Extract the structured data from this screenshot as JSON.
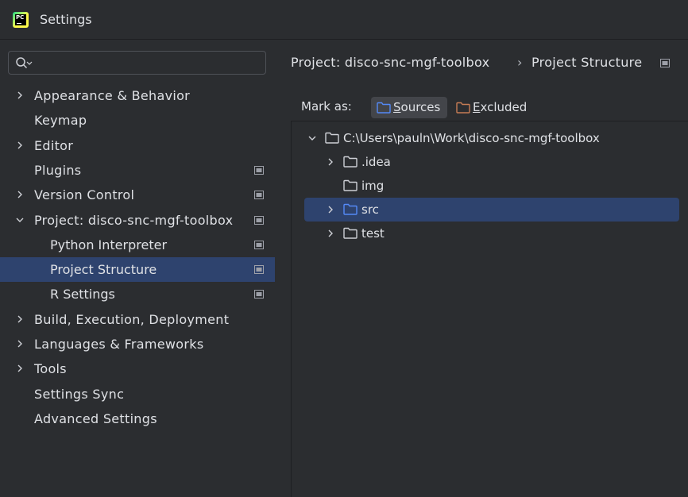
{
  "window": {
    "title": "Settings",
    "logo_text": "PC"
  },
  "search": {
    "value": "",
    "placeholder": ""
  },
  "sidebar": {
    "items": [
      {
        "label": "Appearance & Behavior",
        "expandable": true,
        "expanded": false,
        "pinned": false
      },
      {
        "label": "Keymap",
        "expandable": false,
        "pinned": false
      },
      {
        "label": "Editor",
        "expandable": true,
        "expanded": false,
        "pinned": false
      },
      {
        "label": "Plugins",
        "expandable": false,
        "pinned": true
      },
      {
        "label": "Version Control",
        "expandable": true,
        "expanded": false,
        "pinned": true
      },
      {
        "label": "Project: disco-snc-mgf-toolbox",
        "expandable": true,
        "expanded": true,
        "pinned": true
      },
      {
        "label": "Python Interpreter",
        "child": true,
        "pinned": true
      },
      {
        "label": "Project Structure",
        "child": true,
        "pinned": true,
        "selected": true
      },
      {
        "label": "R Settings",
        "child": true,
        "pinned": true
      },
      {
        "label": "Build, Execution, Deployment",
        "expandable": true,
        "expanded": false,
        "pinned": false
      },
      {
        "label": "Languages & Frameworks",
        "expandable": true,
        "expanded": false,
        "pinned": false
      },
      {
        "label": "Tools",
        "expandable": true,
        "expanded": false,
        "pinned": false
      },
      {
        "label": "Settings Sync",
        "expandable": false,
        "pinned": false
      },
      {
        "label": "Advanced Settings",
        "expandable": false,
        "pinned": false
      }
    ]
  },
  "breadcrumb": {
    "parent": "Project: disco-snc-mgf-toolbox",
    "separator": "›",
    "current": "Project Structure"
  },
  "mark_as": {
    "label": "Mark as:",
    "sources_mnemonic": "S",
    "sources_rest": "ources",
    "excluded_mnemonic": "E",
    "excluded_rest": "xcluded"
  },
  "file_tree": {
    "root": "C:\\Users\\pauln\\Work\\disco-snc-mgf-toolbox",
    "children": [
      {
        "name": ".idea",
        "expandable": true,
        "source": false
      },
      {
        "name": "img",
        "expandable": false,
        "source": false
      },
      {
        "name": "src",
        "expandable": true,
        "source": true,
        "selected": true
      },
      {
        "name": "test",
        "expandable": true,
        "source": false
      }
    ]
  },
  "colors": {
    "background": "#2b2d30",
    "selection": "#2e436e",
    "source_folder": "#548af7",
    "excluded_folder": "#c77d55",
    "text": "#dfe1e5"
  }
}
